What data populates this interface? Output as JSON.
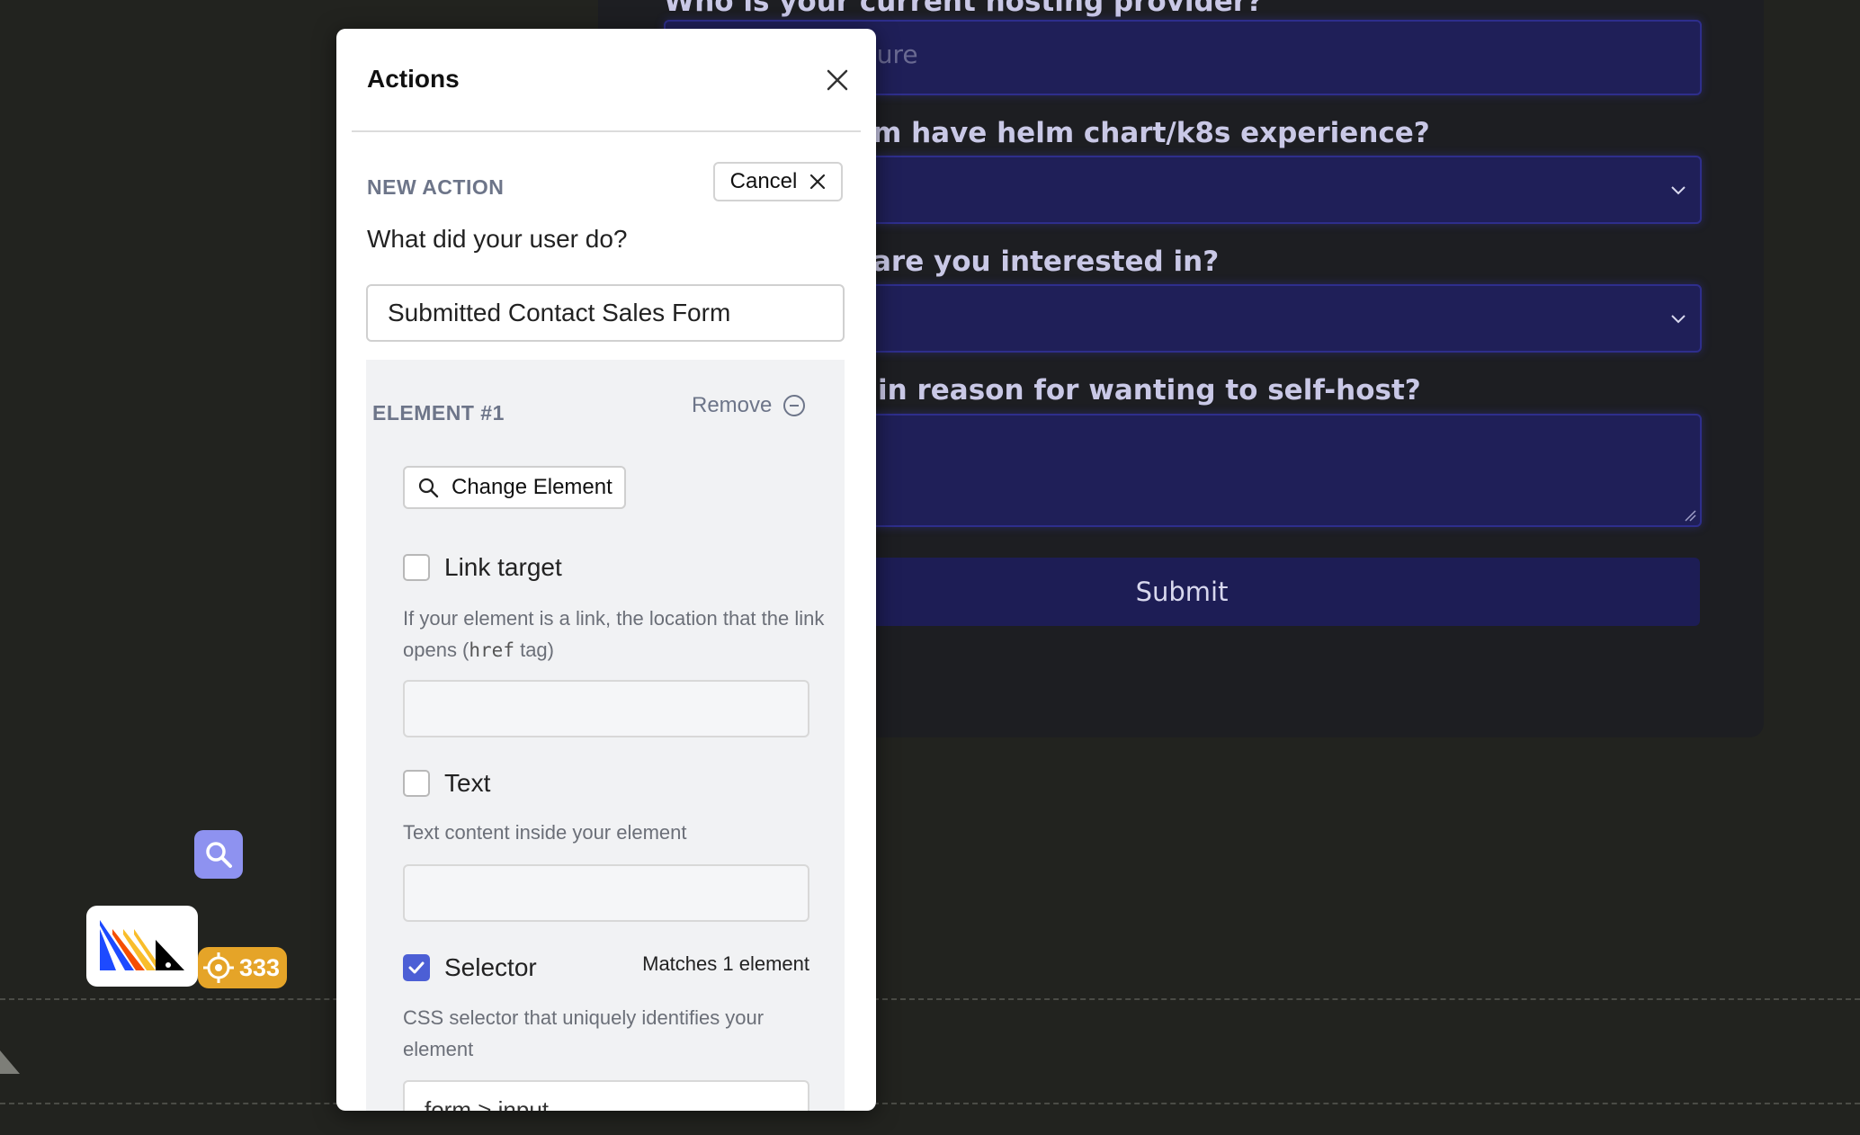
{
  "background": {
    "fields": [
      {
        "label": "Who is your current hosting provider?",
        "placeholder": "zure"
      },
      {
        "label": "m have helm chart/k8s experience?"
      },
      {
        "label": "are you interested in?"
      },
      {
        "label": "in reason for wanting to self-host?"
      }
    ],
    "submit_label": "Submit",
    "toolbar_count": "333"
  },
  "modal": {
    "title": "Actions",
    "new_action_label": "NEW ACTION",
    "cancel_label": "Cancel",
    "question": "What did your user do?",
    "action_name": "Submitted Contact Sales Form",
    "element": {
      "title": "ELEMENT #1",
      "remove_label": "Remove",
      "change_element_label": "Change Element",
      "link_target": {
        "label": "Link target",
        "checked": false,
        "help_pre": "If your element is a link, the location that the link opens (",
        "help_code": "href",
        "help_post": " tag)",
        "value": ""
      },
      "text": {
        "label": "Text",
        "checked": false,
        "help": "Text content inside your element",
        "value": ""
      },
      "selector": {
        "label": "Selector",
        "checked": true,
        "matches": "Matches 1 element",
        "help": "CSS selector that uniquely identifies your element",
        "value": "form > input"
      }
    }
  },
  "colors": {
    "accent": "#4c5fd5",
    "muted_label": "#6d7589",
    "badge": "#e5a428",
    "background": "#22231f"
  }
}
